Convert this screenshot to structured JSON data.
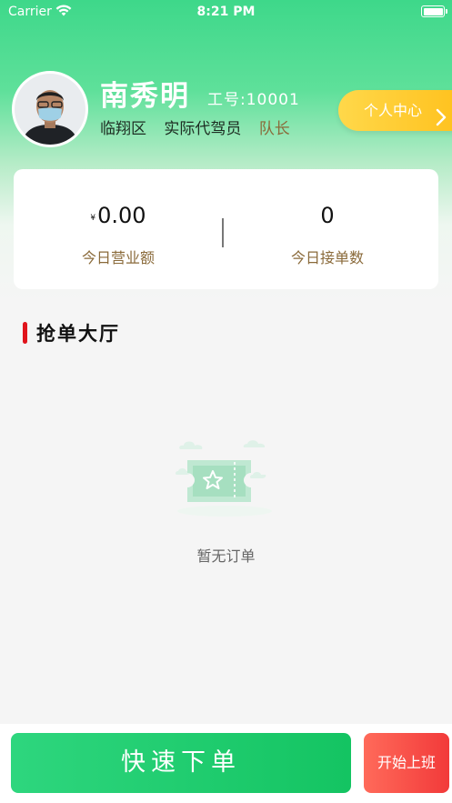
{
  "status_bar": {
    "carrier": "Carrier",
    "time": "8:21 PM"
  },
  "profile": {
    "name": "南秀明",
    "employee_no": "工号:10001",
    "district": "临翔区",
    "position": "实际代驾员",
    "role": "队长",
    "center_button": "个人中心"
  },
  "stats": {
    "revenue_currency": "¥",
    "revenue_value": "0.00",
    "revenue_label": "今日营业额",
    "orders_value": "0",
    "orders_label": "今日接单数"
  },
  "section": {
    "title": "抢单大厅"
  },
  "empty": {
    "text": "暂无订单"
  },
  "bottom": {
    "quick_order": "快速下单",
    "start_work": "开始上班"
  },
  "colors": {
    "brand_green": "#2ed67e",
    "accent_gold": "#ffc21f",
    "danger_red": "#f23a3a",
    "label_brown": "#8a6a3a"
  }
}
